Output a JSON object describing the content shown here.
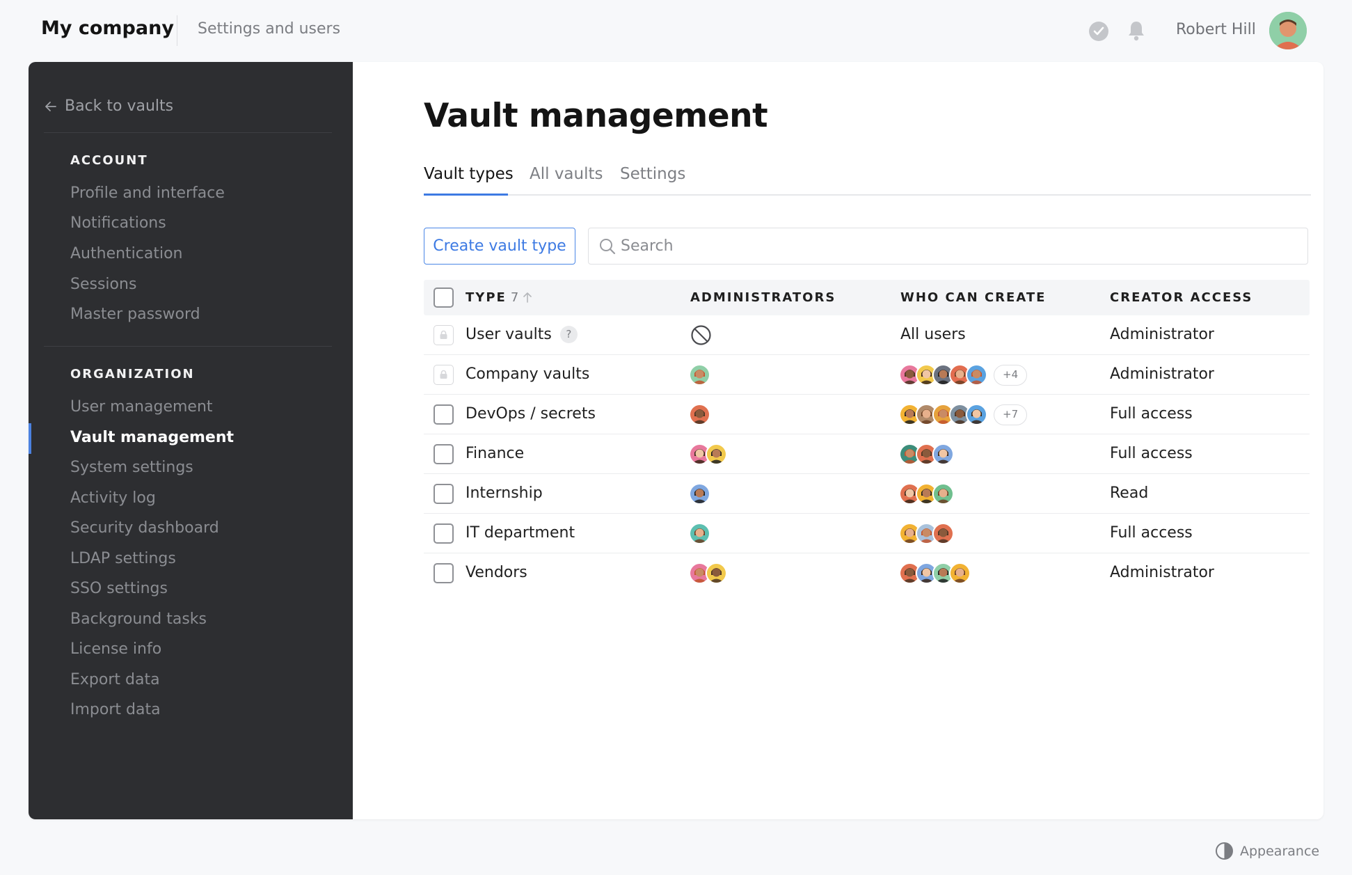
{
  "header": {
    "brand": "My company",
    "breadcrumb": "Settings and users",
    "user_name": "Robert Hill"
  },
  "sidebar": {
    "back_label": "Back to vaults",
    "account_heading": "ACCOUNT",
    "account_items": [
      {
        "label": "Profile and interface"
      },
      {
        "label": "Notifications"
      },
      {
        "label": "Authentication"
      },
      {
        "label": "Sessions"
      },
      {
        "label": "Master password"
      }
    ],
    "org_heading": "ORGANIZATION",
    "org_items": [
      {
        "label": "User management"
      },
      {
        "label": "Vault management",
        "active": true
      },
      {
        "label": "System settings"
      },
      {
        "label": "Activity log"
      },
      {
        "label": "Security dashboard"
      },
      {
        "label": "LDAP settings"
      },
      {
        "label": "SSO settings"
      },
      {
        "label": "Background tasks"
      },
      {
        "label": "License info"
      },
      {
        "label": "Export data"
      },
      {
        "label": "Import data"
      }
    ]
  },
  "main": {
    "title": "Vault management",
    "tabs": [
      {
        "label": "Vault types",
        "active": true
      },
      {
        "label": "All vaults"
      },
      {
        "label": "Settings"
      }
    ],
    "create_button": "Create vault type",
    "search_placeholder": "Search"
  },
  "table": {
    "columns": {
      "type": "TYPE",
      "type_count": "7",
      "administrators": "ADMINISTRATORS",
      "who_can_create": "WHO CAN CREATE",
      "creator_access": "CREATOR ACCESS"
    },
    "rows": [
      {
        "type": "User vaults",
        "help": "?",
        "locked": true,
        "admins": [],
        "no_admins_icon": "prohibited-icon",
        "creators_text": "All users",
        "creators": [],
        "creators_more": "",
        "access": "Administrator"
      },
      {
        "type": "Company vaults",
        "help": "",
        "locked": true,
        "admins": [
          "#8fcfa7"
        ],
        "creators_text": "",
        "creators": [
          "#e8789c",
          "#f2c94c",
          "#6b7280",
          "#e26d4f",
          "#5aa2e0"
        ],
        "creators_more": "+4",
        "access": "Administrator"
      },
      {
        "type": "DevOps / secrets",
        "help": "",
        "locked": false,
        "admins": [
          "#e0704f"
        ],
        "creators_text": "",
        "creators": [
          "#f2b233",
          "#b08a6a",
          "#e6a23c",
          "#7d8f9f",
          "#5aa2e0"
        ],
        "creators_more": "+7",
        "access": "Full access"
      },
      {
        "type": "Finance",
        "help": "",
        "locked": false,
        "admins": [
          "#e8789c",
          "#f2c94c"
        ],
        "creators_text": "",
        "creators": [
          "#3c8d7a",
          "#e0704f",
          "#7fa7e0"
        ],
        "creators_more": "",
        "access": "Full access"
      },
      {
        "type": "Internship",
        "help": "",
        "locked": false,
        "admins": [
          "#7fa7e0"
        ],
        "creators_text": "",
        "creators": [
          "#e0704f",
          "#f2b233",
          "#6fbf8e"
        ],
        "creators_more": "",
        "access": "Read"
      },
      {
        "type": "IT department",
        "help": "",
        "locked": false,
        "admins": [
          "#5cbfb0"
        ],
        "creators_text": "",
        "creators": [
          "#f2b233",
          "#a9c2dc",
          "#e0704f"
        ],
        "creators_more": "",
        "access": "Full access"
      },
      {
        "type": "Vendors",
        "help": "",
        "locked": false,
        "admins": [
          "#e8789c",
          "#f2c94c"
        ],
        "creators_text": "",
        "creators": [
          "#e0704f",
          "#7fa7e0",
          "#8fcfa7",
          "#f2b233"
        ],
        "creators_more": "",
        "access": "Administrator"
      }
    ]
  },
  "footer": {
    "appearance_label": "Appearance"
  },
  "colors": {
    "accent": "#3d7ae3",
    "sidebar_bg": "#2d2e31",
    "page_bg": "#f7f8fa"
  }
}
